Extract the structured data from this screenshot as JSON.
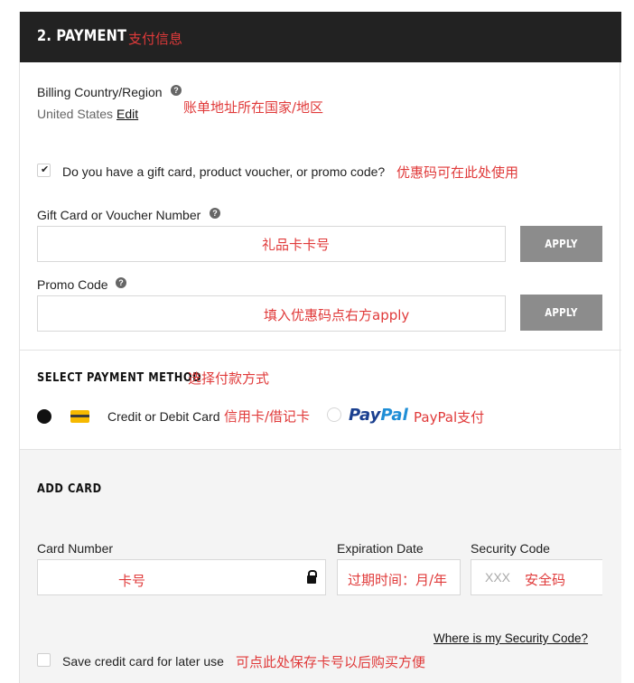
{
  "header": {
    "title": "2. PAYMENT",
    "note": "支付信息"
  },
  "billing": {
    "label": "Billing Country/Region",
    "value": "United States",
    "edit_label": "Edit",
    "note": "账单地址所在国家/地区"
  },
  "gift_toggle": {
    "checked": true,
    "label": "Do you have a gift card, product voucher, or promo code?",
    "note": "优惠码可在此处使用"
  },
  "gift_card": {
    "label": "Gift Card or Voucher Number",
    "note": "礼品卡卡号",
    "apply_label": "APPLY"
  },
  "promo": {
    "label": "Promo Code",
    "note": "填入优惠码点右方apply",
    "apply_label": "APPLY"
  },
  "payment_method": {
    "title": "SELECT PAYMENT METHOD",
    "note": "选择付款方式",
    "card_option": {
      "label": "Credit or Debit Card",
      "note": "信用卡/借记卡",
      "selected": true
    },
    "paypal_option": {
      "brand_pay": "Pay",
      "brand_pal": "Pal",
      "note": "PayPal支付",
      "selected": false
    }
  },
  "add_card": {
    "title": "ADD CARD",
    "card_number": {
      "label": "Card Number",
      "note": "卡号"
    },
    "expiration": {
      "label": "Expiration Date",
      "note": "过期时间：月/年"
    },
    "security": {
      "label": "Security Code",
      "placeholder": "XXX",
      "note": "安全码"
    },
    "security_help_link": "Where is my Security Code?",
    "save_card": {
      "checked": false,
      "label": "Save credit card for later use",
      "note": "可点此处保存卡号以后购买方便"
    }
  },
  "colors": {
    "header_bg": "#222222",
    "apply_bg": "#8c8c8c",
    "annotation": "#e03a3a",
    "card_icon": "#f6b900"
  }
}
